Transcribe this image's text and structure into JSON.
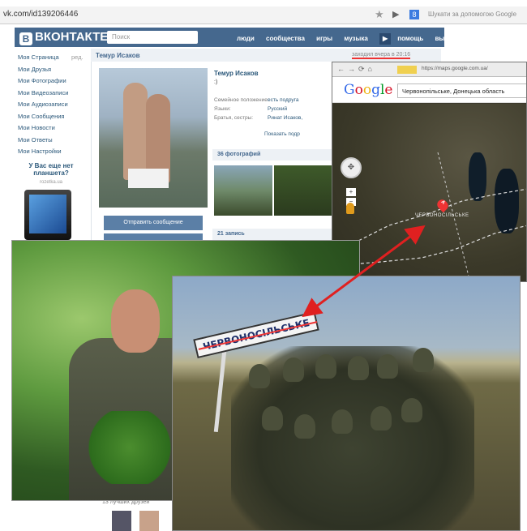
{
  "browser": {
    "url": "vk.com/id139206446",
    "search_placeholder": "Шукати за допомогою Google"
  },
  "vk": {
    "logo": "ВКОНТАКТЕ",
    "search_placeholder": "Поиск",
    "nav": [
      "люди",
      "сообщества",
      "игры",
      "музыка",
      "помощь",
      "выйти"
    ],
    "sidebar": [
      "Моя Страница",
      "Мои Друзья",
      "Мои Фотографии",
      "Мои Видеозаписи",
      "Мои Аудиозаписи",
      "Мои Сообщения",
      "Мои Новости",
      "Мои Ответы",
      "Мои Настройки"
    ],
    "sidebar_edit": "ред.",
    "promo_title": "У Вас еще нет планшета?",
    "promo_url": "rozetka.ua",
    "page_name": "Темур Исаков",
    "online": "заходил вчера в 20:16",
    "profile_name": "Темур Исаков",
    "profile_status": ":)",
    "info": [
      {
        "label": "Семейное положение:",
        "value": "есть подруга"
      },
      {
        "label": "Языки:",
        "value": "Русский"
      },
      {
        "label": "Братья, сестры:",
        "value": "Ринат Исаков,"
      }
    ],
    "show_more": "Показать подр",
    "photos_count": "36 фотографий",
    "posts_count": "21 запись",
    "send_message": "Отправить сообщение",
    "friends_label": "13 лучших друзей"
  },
  "map": {
    "url": "https://maps.google.com.ua/",
    "query": "Червонопільське, Донецька область",
    "place_label": "ЧЕРВОНОСІЛЬСЬКЕ",
    "marker": "A"
  },
  "photo": {
    "sign_text": "ЧЕРВОНОСІЛЬСЬКЕ"
  },
  "colors": {
    "vk_blue": "#45688e",
    "vk_link": "#2b587a",
    "arrow_red": "#e02020"
  }
}
